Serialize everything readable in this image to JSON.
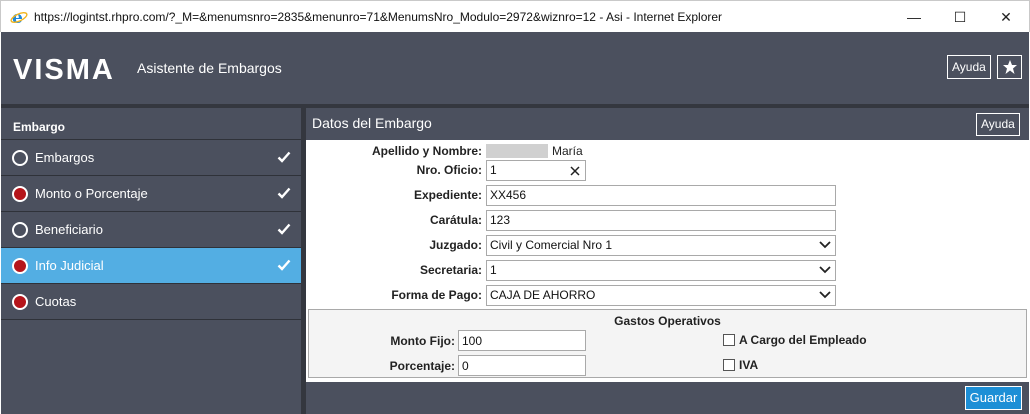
{
  "window": {
    "title": "https://logintst.rhpro.com/?_M=&menumsnro=2835&menunro=71&MenumsNro_Modulo=2972&wiznro=12 - Asi - Internet Explorer",
    "controls": {
      "minimize": "—",
      "maximize": "☐",
      "close": "✕"
    }
  },
  "header": {
    "logo": "VISMA",
    "app_title": "Asistente de Embargos",
    "help_label": "Ayuda"
  },
  "sidebar": {
    "title": "Embargo",
    "items": [
      {
        "label": "Embargos",
        "status": "empty",
        "checked": true
      },
      {
        "label": "Monto o Porcentaje",
        "status": "red",
        "checked": true
      },
      {
        "label": "Beneficiario",
        "status": "empty",
        "checked": true
      },
      {
        "label": "Info Judicial",
        "status": "red",
        "checked": true,
        "active": true
      },
      {
        "label": "Cuotas",
        "status": "red",
        "checked": false
      }
    ]
  },
  "panel": {
    "title": "Datos del Embargo",
    "help_label": "Ayuda",
    "fields": {
      "apellido_label": "Apellido y Nombre:",
      "apellido_value": "María",
      "oficio_label": "Nro. Oficio:",
      "oficio_value": "1",
      "expediente_label": "Expediente:",
      "expediente_value": "XX456",
      "caratula_label": "Carátula:",
      "caratula_value": "123",
      "juzgado_label": "Juzgado:",
      "juzgado_value": "Civil y Comercial Nro 1",
      "secretaria_label": "Secretaria:",
      "secretaria_value": "1",
      "forma_pago_label": "Forma de Pago:",
      "forma_pago_value": "CAJA DE AHORRO"
    },
    "gastos": {
      "title": "Gastos Operativos",
      "monto_fijo_label": "Monto Fijo:",
      "monto_fijo_value": "100",
      "porcentaje_label": "Porcentaje:",
      "porcentaje_value": "0",
      "a_cargo_label": "A Cargo del Empleado",
      "iva_label": "IVA"
    },
    "save_label": "Guardar"
  },
  "colors": {
    "header_bg": "#4b505e",
    "active_item": "#53aee3",
    "status_red": "#b5151b",
    "save_button": "#1d8fd6"
  }
}
